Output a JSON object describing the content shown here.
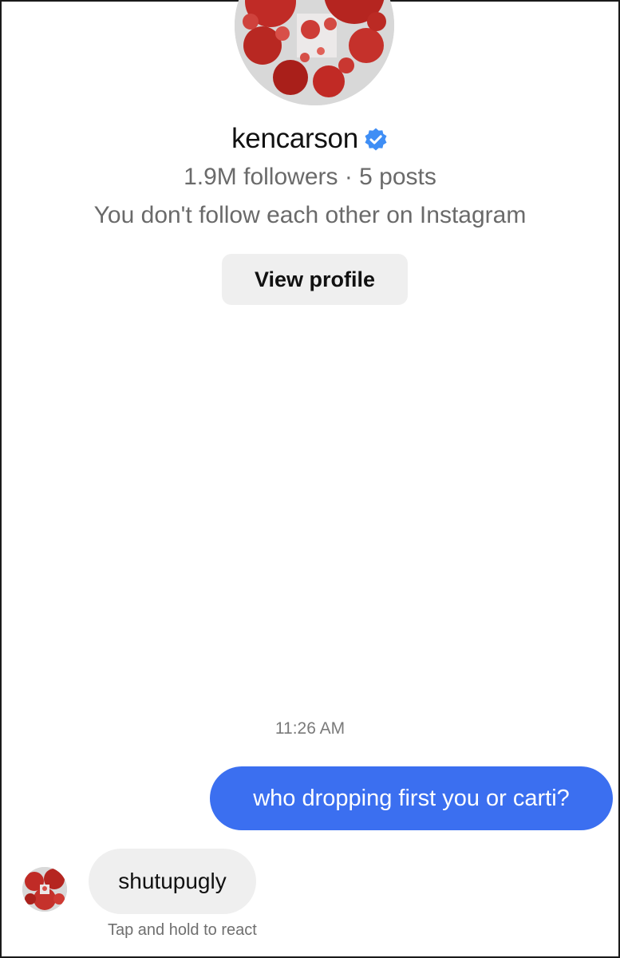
{
  "profile": {
    "username": "kencarson",
    "verified": true,
    "stats": "1.9M followers · 5 posts",
    "follow_status": "You don't follow each other on Instagram",
    "view_profile_label": "View profile"
  },
  "conversation": {
    "timestamp": "11:26 AM",
    "messages": [
      {
        "direction": "sent",
        "text": "who dropping first you or carti?"
      },
      {
        "direction": "received",
        "text": "shutupugly"
      }
    ],
    "react_hint": "Tap and hold to react"
  },
  "colors": {
    "sent_bubble": "#3b6ff0",
    "received_bubble": "#efefef",
    "verified_badge": "#3f8ef5",
    "secondary_text": "#6a6a6a"
  },
  "icons": {
    "verified": "verified-badge-icon",
    "profile_avatar": "profile-avatar",
    "sender_avatar": "sender-avatar"
  }
}
